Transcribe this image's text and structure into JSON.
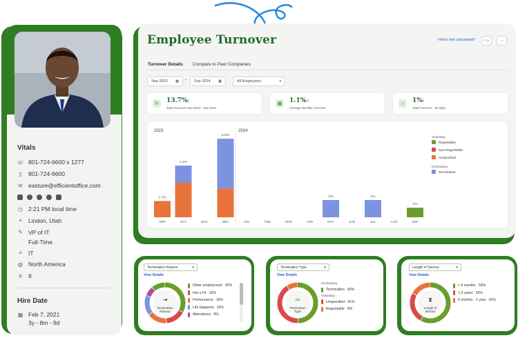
{
  "profile": {
    "vitals_title": "Vitals",
    "phone_work": "801-724-6600 x 1277",
    "phone_mobile": "801-724-6600",
    "email": "easture@efficientoffice.com",
    "local_time": "2:21 PM local time",
    "location": "Lindon, Utah",
    "job_title": "VP of IT",
    "employment_type": "Full-Time",
    "department": "IT",
    "region": "North America",
    "reports_count": "9",
    "hire_date_title": "Hire Date",
    "hire_date": "Feb 7, 2021",
    "tenure": "3y - 8m - 9d"
  },
  "header": {
    "title": "Employee Turnover",
    "how_calculated": "How's this calculated?"
  },
  "tabs": [
    {
      "label": "Turnover Details",
      "active": true
    },
    {
      "label": "Compare to Peer Companies",
      "active": false
    }
  ],
  "filters": {
    "start": "Sep 2023",
    "separator": "–",
    "end": "Sep 2024",
    "group": "All Employees"
  },
  "kpis": [
    {
      "value": "13.7%",
      "sub": "12",
      "caption": "Total Turnover Sep 2023 - Sep 2024",
      "icon": "refresh-icon"
    },
    {
      "value": "1.1%",
      "sub": "0.9",
      "caption": "Average Monthly Turnover",
      "icon": "calendar-icon"
    },
    {
      "value": "1%",
      "sub": "1",
      "caption": "Total Turnover · 30 days",
      "icon": "people-icon"
    }
  ],
  "chart_data": {
    "type": "bar",
    "year_labels": [
      "2023",
      "2024"
    ],
    "categories": [
      "SEP",
      "OCT",
      "NOV",
      "DEC",
      "JAN",
      "FEB",
      "MAR",
      "APR",
      "MAY",
      "JUN",
      "JUL",
      "AUG",
      "SEP"
    ],
    "totals": [
      "1.7%",
      "4.4%",
      "",
      "5.5%",
      "",
      "",
      "",
      "",
      "1%",
      "",
      "1%",
      "",
      "1%"
    ],
    "series": [
      {
        "name": "Regrettable",
        "color": "#6a9e2c",
        "values": [
          0,
          0,
          0,
          0,
          0,
          0,
          0,
          0,
          0,
          0,
          0,
          0,
          1.0
        ]
      },
      {
        "name": "Non-Regrettable",
        "color": "#d94a4a",
        "values": [
          0,
          0,
          0,
          0,
          0,
          0,
          0,
          0,
          0,
          0,
          0,
          0,
          0
        ]
      },
      {
        "name": "Unspecified",
        "color": "#e8743b",
        "values": [
          1.7,
          3.6,
          0,
          3.0,
          0,
          0,
          0,
          0,
          0,
          0,
          0,
          0,
          0
        ]
      },
      {
        "name": "Termination",
        "color": "#7b93e0",
        "values": [
          0,
          1.8,
          0,
          5.2,
          0,
          0,
          0,
          0,
          1.8,
          0,
          1.8,
          0,
          0
        ]
      }
    ],
    "legend_groups": [
      {
        "title": "Voluntary",
        "items": [
          "Regrettable",
          "Non-Regrettable",
          "Unspecified"
        ]
      },
      {
        "title": "Involuntary",
        "items": [
          "Termination"
        ]
      }
    ],
    "ylim": [
      0,
      9
    ]
  },
  "bottom_cards": [
    {
      "dropdown": "Termination Reason",
      "view_details": "View Details",
      "center_label": "Termination\nReason",
      "center_icon": "person-exit-icon",
      "legend": [
        {
          "label": "Other employment",
          "pct": "33%",
          "color": "#6a9e2c"
        },
        {
          "label": "Not a Fit",
          "pct": "16%",
          "color": "#d94a4a"
        },
        {
          "label": "Performance",
          "pct": "16%",
          "color": "#e8743b"
        },
        {
          "label": "Life Happens",
          "pct": "16%",
          "color": "#7b93e0"
        },
        {
          "label": "Attendance",
          "pct": "8%",
          "color": "#b04fa0"
        }
      ],
      "ring": [
        {
          "value": 33,
          "color": "#6a9e2c"
        },
        {
          "value": 16,
          "color": "#d94a4a"
        },
        {
          "value": 16,
          "color": "#e8743b"
        },
        {
          "value": 16,
          "color": "#7b93e0"
        },
        {
          "value": 8,
          "color": "#b04fa0"
        },
        {
          "value": 11,
          "color": "#6a9e2c"
        }
      ]
    },
    {
      "dropdown": "Termination Type",
      "view_details": "View Details",
      "center_label": "Termination\nType",
      "center_icon": "running-exit-icon",
      "legend_groups": [
        {
          "title": "Involuntary",
          "items": [
            {
              "label": "Termination",
              "pct": "50%",
              "color": "#6a9e2c"
            }
          ]
        },
        {
          "title": "Voluntary",
          "items": [
            {
              "label": "Unspecified",
              "pct": "41%",
              "color": "#d94a4a"
            },
            {
              "label": "Regrettable",
              "pct": "8%",
              "color": "#e8743b"
            }
          ]
        }
      ],
      "ring": [
        {
          "value": 50,
          "color": "#6a9e2c"
        },
        {
          "value": 41,
          "color": "#d94a4a"
        },
        {
          "value": 9,
          "color": "#e8743b"
        }
      ]
    },
    {
      "dropdown": "Length of Service",
      "view_details": "View Details",
      "center_label": "Length of\nService",
      "center_icon": "hourglass-icon",
      "legend": [
        {
          "label": "< 6 months",
          "pct": "58%",
          "color": "#6a9e2c"
        },
        {
          "label": "1-3 years",
          "pct": "25%",
          "color": "#d94a4a"
        },
        {
          "label": "6 months - 1 year",
          "pct": "16%",
          "color": "#e8743b"
        }
      ],
      "ring": [
        {
          "value": 58,
          "color": "#6a9e2c"
        },
        {
          "value": 25,
          "color": "#d94a4a"
        },
        {
          "value": 17,
          "color": "#e8743b"
        }
      ]
    }
  ]
}
